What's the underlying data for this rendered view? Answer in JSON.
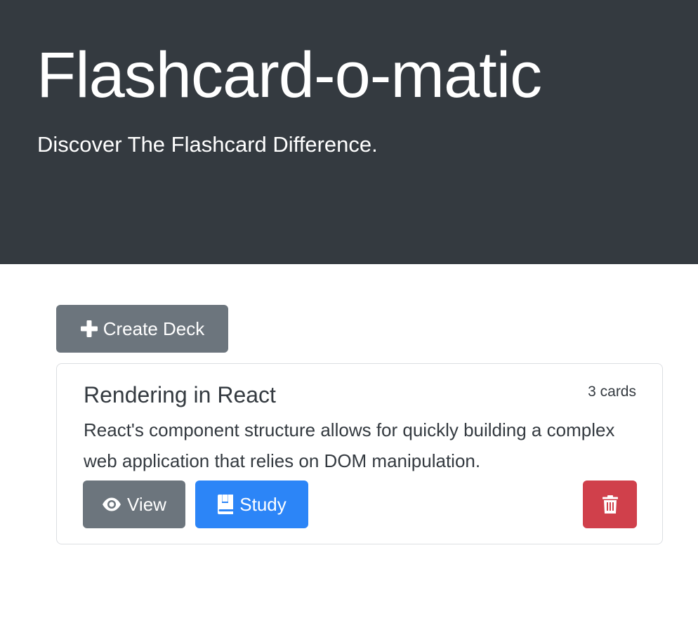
{
  "header": {
    "title": "Flashcard-o-matic",
    "tagline": "Discover The Flashcard Difference."
  },
  "toolbar": {
    "create_deck_label": "Create Deck",
    "create_deck_icon": "plus-icon"
  },
  "decks": [
    {
      "name": "Rendering in React",
      "card_count": "3 cards",
      "description": "React's component structure allows for quickly building a complex web application that relies on DOM manipulation.",
      "view_label": "View",
      "view_icon": "eye-icon",
      "study_label": "Study",
      "study_icon": "book-icon",
      "delete_icon": "trash-icon"
    }
  ],
  "colors": {
    "header_bg": "#343a40",
    "secondary": "#6c757d",
    "primary": "#2c85f7",
    "danger": "#d0404b"
  }
}
